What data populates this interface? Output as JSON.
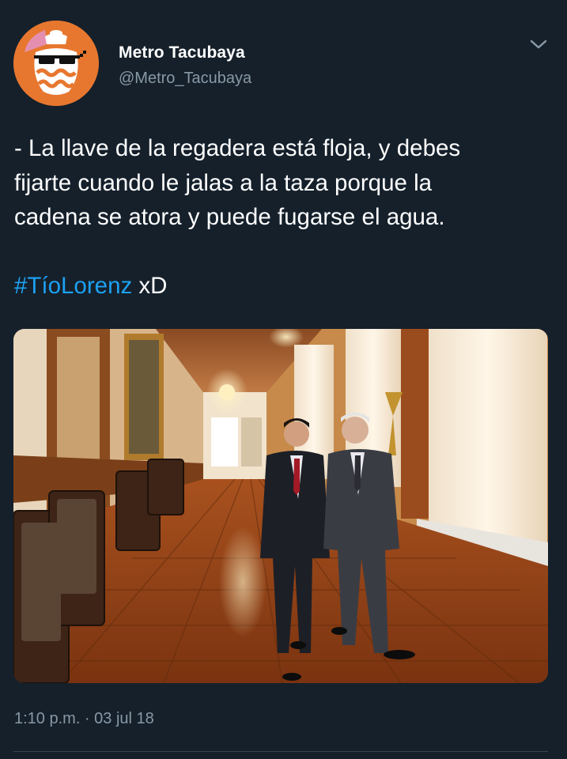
{
  "author": {
    "display_name": "Metro Tacubaya",
    "handle": "@Metro_Tacubaya"
  },
  "tweet": {
    "text_lines": [
      "- La llave de la regadera está floja, y debes",
      "fijarte cuando le jalas a la taza porque la",
      "cadena se atora y puede fugarse el agua."
    ],
    "hashtag": "#TíoLorenz",
    "hashtag_suffix": " xD",
    "timestamp": "1:10 p.m. · 03 jul 18"
  },
  "icons": {
    "menu": "chevron-down-icon",
    "avatar": "metro-tacubaya-pot-logo"
  },
  "colors": {
    "background": "#15202b",
    "link": "#1da1f2",
    "secondary_text": "#8899a6",
    "avatar_bg": "#e7772f"
  }
}
